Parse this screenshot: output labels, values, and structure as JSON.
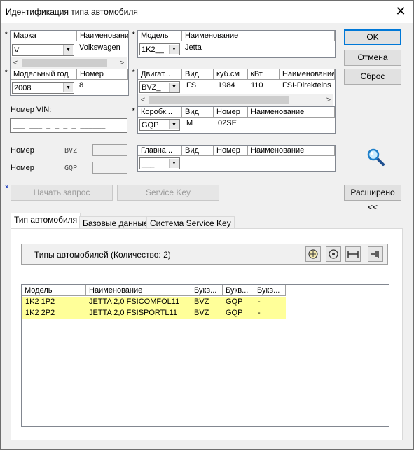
{
  "window": {
    "title": "Идентификация типа автомобиля",
    "close_glyph": "✕"
  },
  "make": {
    "col_make": "Марка",
    "col_name": "Наименование",
    "value": "V",
    "name": "Volkswagen"
  },
  "model": {
    "col_model": "Модель",
    "col_name": "Наименование",
    "value": "1K2__",
    "name": "Jetta"
  },
  "year": {
    "col_year": "Модельный год",
    "col_number": "Номер",
    "value": "2008",
    "number": "8"
  },
  "engine": {
    "headers": [
      "Двигат...",
      "Вид",
      "куб.см",
      "кВт",
      "Наименование"
    ],
    "code": "BVZ_",
    "type": "FS",
    "cc": "1984",
    "kw": "110",
    "name": "FSI-Direkteins"
  },
  "gearbox": {
    "headers": [
      "Коробк...",
      "Вид",
      "Номер",
      "Наименование"
    ],
    "code": "GQP",
    "type": "M",
    "number": "02SE"
  },
  "main_gear": {
    "headers": [
      "Главна...",
      "Вид",
      "Номер",
      "Наименование"
    ],
    "code": "___"
  },
  "vin": {
    "label": "Номер VIN:",
    "placeholder": "___ ___ _ _ _ _ ______"
  },
  "numbers": [
    {
      "label": "Номер",
      "code": "BVZ"
    },
    {
      "label": "Номер",
      "code": "GQP"
    }
  ],
  "buttons": {
    "ok": "OK",
    "cancel": "Отмена",
    "reset": "Сброс",
    "start_query": "Начать запрос",
    "service_key": "Service Key",
    "extended": "Расширено <<"
  },
  "tabs": [
    "Тип автомобиля",
    "Базовые данные",
    "Система Service Key"
  ],
  "panel": {
    "title": "Типы автомобилей (Количество: 2)"
  },
  "results": {
    "headers": [
      "Модель",
      "Наименование",
      "Букв...",
      "Букв...",
      "Букв..."
    ],
    "rows": [
      [
        "1K2 1P2",
        "JETTA 2,0 FSICOMFOL11",
        "BVZ",
        "GQP",
        "-"
      ],
      [
        "1K2 2P2",
        "JETTA 2,0 FSISPORTL11",
        "BVZ",
        "GQP",
        "-"
      ]
    ]
  },
  "icons": [
    "search-icon",
    "filter-icon",
    "settings-icon",
    "range-icon",
    "pin-icon"
  ],
  "colors": {
    "highlight_row": "#ffff99",
    "default_button_border": "#0078d7"
  }
}
